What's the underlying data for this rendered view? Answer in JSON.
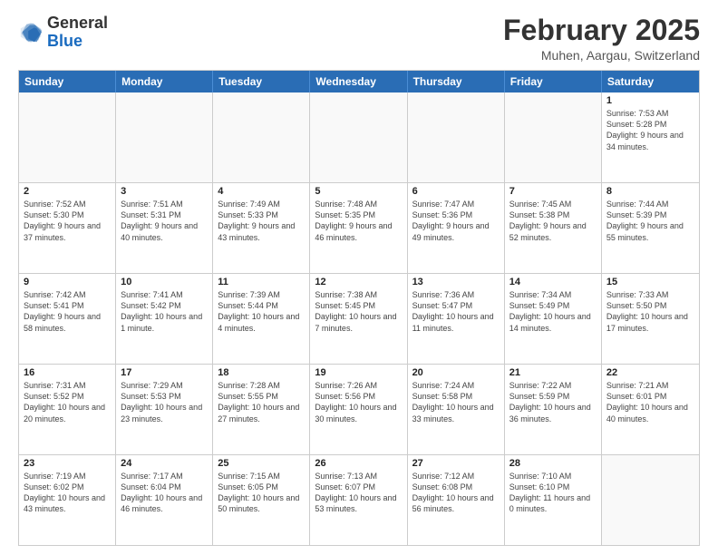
{
  "header": {
    "logo_general": "General",
    "logo_blue": "Blue",
    "month_title": "February 2025",
    "location": "Muhen, Aargau, Switzerland"
  },
  "days_of_week": [
    "Sunday",
    "Monday",
    "Tuesday",
    "Wednesday",
    "Thursday",
    "Friday",
    "Saturday"
  ],
  "weeks": [
    [
      {
        "day": "",
        "info": ""
      },
      {
        "day": "",
        "info": ""
      },
      {
        "day": "",
        "info": ""
      },
      {
        "day": "",
        "info": ""
      },
      {
        "day": "",
        "info": ""
      },
      {
        "day": "",
        "info": ""
      },
      {
        "day": "1",
        "info": "Sunrise: 7:53 AM\nSunset: 5:28 PM\nDaylight: 9 hours and 34 minutes."
      }
    ],
    [
      {
        "day": "2",
        "info": "Sunrise: 7:52 AM\nSunset: 5:30 PM\nDaylight: 9 hours and 37 minutes."
      },
      {
        "day": "3",
        "info": "Sunrise: 7:51 AM\nSunset: 5:31 PM\nDaylight: 9 hours and 40 minutes."
      },
      {
        "day": "4",
        "info": "Sunrise: 7:49 AM\nSunset: 5:33 PM\nDaylight: 9 hours and 43 minutes."
      },
      {
        "day": "5",
        "info": "Sunrise: 7:48 AM\nSunset: 5:35 PM\nDaylight: 9 hours and 46 minutes."
      },
      {
        "day": "6",
        "info": "Sunrise: 7:47 AM\nSunset: 5:36 PM\nDaylight: 9 hours and 49 minutes."
      },
      {
        "day": "7",
        "info": "Sunrise: 7:45 AM\nSunset: 5:38 PM\nDaylight: 9 hours and 52 minutes."
      },
      {
        "day": "8",
        "info": "Sunrise: 7:44 AM\nSunset: 5:39 PM\nDaylight: 9 hours and 55 minutes."
      }
    ],
    [
      {
        "day": "9",
        "info": "Sunrise: 7:42 AM\nSunset: 5:41 PM\nDaylight: 9 hours and 58 minutes."
      },
      {
        "day": "10",
        "info": "Sunrise: 7:41 AM\nSunset: 5:42 PM\nDaylight: 10 hours and 1 minute."
      },
      {
        "day": "11",
        "info": "Sunrise: 7:39 AM\nSunset: 5:44 PM\nDaylight: 10 hours and 4 minutes."
      },
      {
        "day": "12",
        "info": "Sunrise: 7:38 AM\nSunset: 5:45 PM\nDaylight: 10 hours and 7 minutes."
      },
      {
        "day": "13",
        "info": "Sunrise: 7:36 AM\nSunset: 5:47 PM\nDaylight: 10 hours and 11 minutes."
      },
      {
        "day": "14",
        "info": "Sunrise: 7:34 AM\nSunset: 5:49 PM\nDaylight: 10 hours and 14 minutes."
      },
      {
        "day": "15",
        "info": "Sunrise: 7:33 AM\nSunset: 5:50 PM\nDaylight: 10 hours and 17 minutes."
      }
    ],
    [
      {
        "day": "16",
        "info": "Sunrise: 7:31 AM\nSunset: 5:52 PM\nDaylight: 10 hours and 20 minutes."
      },
      {
        "day": "17",
        "info": "Sunrise: 7:29 AM\nSunset: 5:53 PM\nDaylight: 10 hours and 23 minutes."
      },
      {
        "day": "18",
        "info": "Sunrise: 7:28 AM\nSunset: 5:55 PM\nDaylight: 10 hours and 27 minutes."
      },
      {
        "day": "19",
        "info": "Sunrise: 7:26 AM\nSunset: 5:56 PM\nDaylight: 10 hours and 30 minutes."
      },
      {
        "day": "20",
        "info": "Sunrise: 7:24 AM\nSunset: 5:58 PM\nDaylight: 10 hours and 33 minutes."
      },
      {
        "day": "21",
        "info": "Sunrise: 7:22 AM\nSunset: 5:59 PM\nDaylight: 10 hours and 36 minutes."
      },
      {
        "day": "22",
        "info": "Sunrise: 7:21 AM\nSunset: 6:01 PM\nDaylight: 10 hours and 40 minutes."
      }
    ],
    [
      {
        "day": "23",
        "info": "Sunrise: 7:19 AM\nSunset: 6:02 PM\nDaylight: 10 hours and 43 minutes."
      },
      {
        "day": "24",
        "info": "Sunrise: 7:17 AM\nSunset: 6:04 PM\nDaylight: 10 hours and 46 minutes."
      },
      {
        "day": "25",
        "info": "Sunrise: 7:15 AM\nSunset: 6:05 PM\nDaylight: 10 hours and 50 minutes."
      },
      {
        "day": "26",
        "info": "Sunrise: 7:13 AM\nSunset: 6:07 PM\nDaylight: 10 hours and 53 minutes."
      },
      {
        "day": "27",
        "info": "Sunrise: 7:12 AM\nSunset: 6:08 PM\nDaylight: 10 hours and 56 minutes."
      },
      {
        "day": "28",
        "info": "Sunrise: 7:10 AM\nSunset: 6:10 PM\nDaylight: 11 hours and 0 minutes."
      },
      {
        "day": "",
        "info": ""
      }
    ]
  ]
}
